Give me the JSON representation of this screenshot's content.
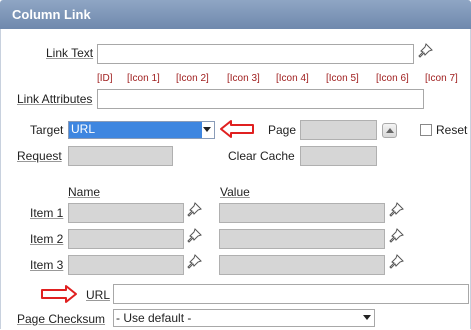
{
  "panel": {
    "title": "Column Link"
  },
  "link_text": {
    "label": "Link Text",
    "value": ""
  },
  "substitutions": [
    "[ID]",
    "[Icon 1]",
    "[Icon 2]",
    "[Icon 3]",
    "[Icon 4]",
    "[Icon 5]",
    "[Icon 6]",
    "[Icon 7]"
  ],
  "link_attributes": {
    "label": "Link Attributes",
    "value": ""
  },
  "target": {
    "label": "Target",
    "selected": "URL"
  },
  "page": {
    "label": "Page",
    "value": ""
  },
  "reset": {
    "label": "Reset"
  },
  "request": {
    "label": "Request",
    "value": ""
  },
  "clear_cache": {
    "label": "Clear Cache",
    "value": ""
  },
  "columns": {
    "name": "Name",
    "value": "Value"
  },
  "items": [
    {
      "label": "Item 1",
      "name": "",
      "value": ""
    },
    {
      "label": "Item 2",
      "name": "",
      "value": ""
    },
    {
      "label": "Item 3",
      "name": "",
      "value": ""
    }
  ],
  "url": {
    "label": "URL",
    "value": ""
  },
  "page_checksum": {
    "label": "Page Checksum",
    "selected": "- Use default -"
  },
  "colors": {
    "header": "#7b93b6",
    "select_highlight": "#3e86e0",
    "annotation_arrow": "#e02020",
    "substitution_text": "#a02020"
  }
}
